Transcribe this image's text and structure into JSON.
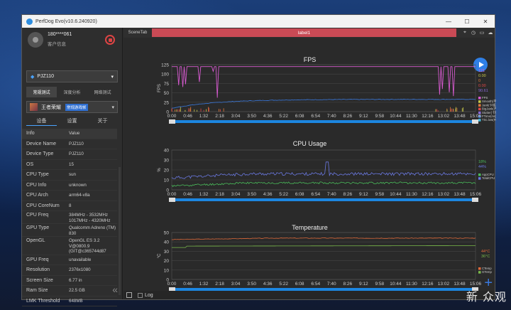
{
  "window": {
    "title": "PerfDog Evo(v10.6.240920)",
    "controls": [
      "—",
      "☐",
      "✕"
    ]
  },
  "user": {
    "name": "180****061",
    "sub": "客户信息"
  },
  "device": {
    "name": "PJZ110"
  },
  "mode_tabs": [
    "常规测试",
    "深度分析",
    "网络测试"
  ],
  "app": {
    "name": "王者荣耀",
    "tag": "常规游戏帧"
  },
  "sub_tabs": [
    "设备",
    "设置",
    "关于"
  ],
  "info": {
    "header": {
      "k": "Info",
      "v": "Value"
    },
    "rows": [
      {
        "k": "Device Name",
        "v": "PJZ110"
      },
      {
        "k": "Device Type",
        "v": "PJZ110"
      },
      {
        "k": "OS",
        "v": "15"
      },
      {
        "k": "CPU Type",
        "v": "sun"
      },
      {
        "k": "CPU Info",
        "v": "unknown"
      },
      {
        "k": "CPU Arch",
        "v": "arm64-v8a"
      },
      {
        "k": "CPU CoreNum",
        "v": "8"
      },
      {
        "k": "CPU Freq",
        "v": "384MHz - 3532MHz 1017MHz - 4320MHz",
        "multi": true
      },
      {
        "k": "GPU Type",
        "v": "Qualcomm Adreno (TM) 830",
        "multi": true
      },
      {
        "k": "OpenGL",
        "v": "OpenGL ES 3.2 V@0800.9 (GIT@c365744d87",
        "multi": true
      },
      {
        "k": "GPU Freq",
        "v": "unavailable"
      },
      {
        "k": "Resolution",
        "v": "2376x1080"
      },
      {
        "k": "Screen Size",
        "v": "6.77 in"
      },
      {
        "k": "Ram Size",
        "v": "22.5 GB"
      },
      {
        "k": "LMK Threshold",
        "v": "648MB"
      }
    ]
  },
  "topbar": {
    "scene_tab": "SceneTab",
    "label": "label1"
  },
  "time_ticks": [
    "0:00",
    "0:46",
    "1:32",
    "2:18",
    "3:04",
    "3:50",
    "4:36",
    "5:22",
    "6:08",
    "6:54",
    "7:40",
    "8:26",
    "9:12",
    "9:58",
    "10:44",
    "11:30",
    "12:16",
    "13:02",
    "13:48",
    "15:06"
  ],
  "slider_start": "0:00",
  "slider_end": "15:06",
  "charts": {
    "fps": {
      "title": "FPS",
      "ylabel": "FPS",
      "yticks": [
        "125",
        "100",
        "75",
        "50",
        "25",
        "0"
      ],
      "current": [
        "121",
        "0.00",
        "0",
        "0.00",
        "90.61"
      ],
      "legend": [
        "FPS",
        "Smooth(平滑帧)",
        "Jank(卡顿次数)",
        "BigJank(严重卡顿)",
        "Stutter(卡顿率)",
        "FTime(ms)",
        "TSc.low(FPS)"
      ],
      "colors": [
        "#d75ad0",
        "#c8c84a",
        "#e07a3a",
        "#e04848",
        "#8a6ad8",
        "#3a7ae0",
        "#4ac0e0"
      ]
    },
    "cpu": {
      "title": "CPU Usage",
      "ylabel": "%",
      "yticks": [
        "40",
        "30",
        "20",
        "10",
        "0"
      ],
      "current": [
        "18%",
        "44%"
      ],
      "legend": [
        "AppCPU",
        "TotalCPU"
      ],
      "colors": [
        "#4aba5a",
        "#6a78e0"
      ]
    },
    "temp": {
      "title": "Temperature",
      "ylabel": "°C",
      "yticks": [
        "50",
        "40",
        "30",
        "20",
        "10",
        "0"
      ],
      "current": [
        "44°C",
        "36°C"
      ],
      "legend": [
        "CTemp",
        "GTemp"
      ],
      "colors": [
        "#e06a3a",
        "#7aba4a"
      ]
    }
  },
  "bottombar": {
    "log_label": "Log"
  },
  "watermark": "新 众观"
}
